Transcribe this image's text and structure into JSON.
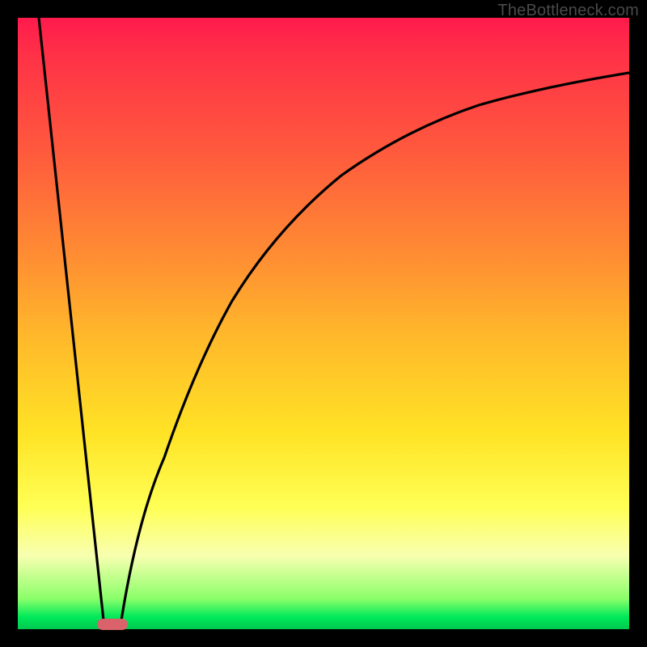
{
  "watermark": "TheBottleneck.com",
  "marker": {
    "x_frac": 0.155,
    "y_frac": 0.992
  },
  "chart_data": {
    "type": "line",
    "title": "",
    "xlabel": "",
    "ylabel": "",
    "xlim": [
      0,
      1
    ],
    "ylim": [
      0,
      1
    ],
    "legend": false,
    "grid": false,
    "background": "heat-gradient (red top → green bottom)",
    "series": [
      {
        "name": "left-line",
        "x": [
          0.035,
          0.14
        ],
        "y": [
          1.0,
          0.015
        ]
      },
      {
        "name": "right-curve",
        "x": [
          0.17,
          0.2,
          0.24,
          0.29,
          0.35,
          0.42,
          0.5,
          0.59,
          0.68,
          0.78,
          0.88,
          1.0
        ],
        "y": [
          0.015,
          0.13,
          0.28,
          0.43,
          0.56,
          0.67,
          0.75,
          0.81,
          0.85,
          0.88,
          0.895,
          0.91
        ]
      }
    ],
    "annotations": [
      {
        "type": "pill",
        "x": 0.155,
        "y": 0.008,
        "color": "#d9626b"
      }
    ]
  }
}
